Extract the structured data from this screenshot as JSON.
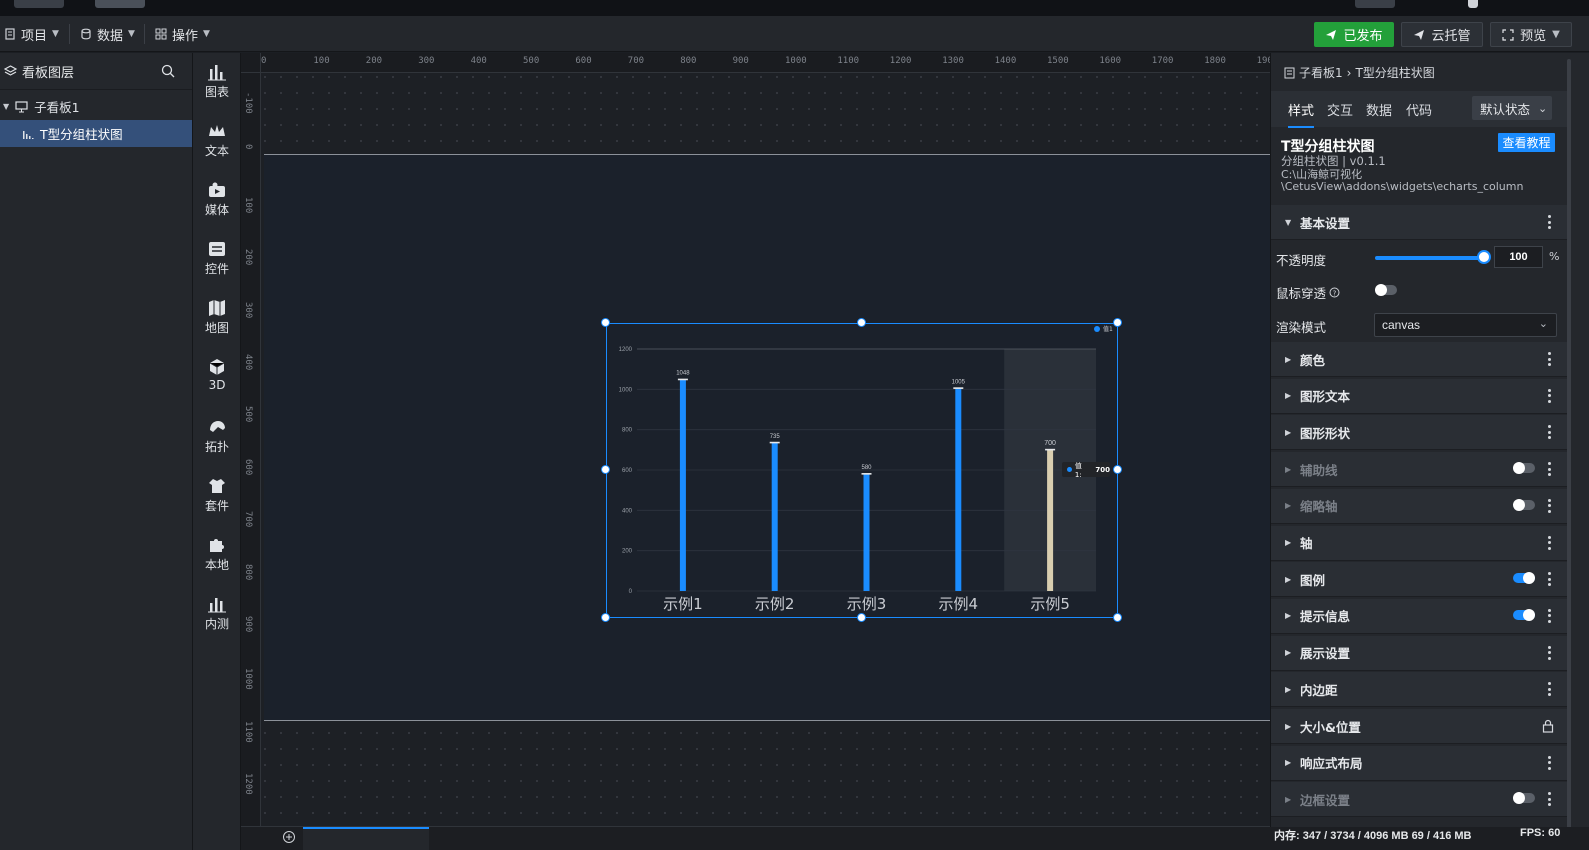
{
  "toolbar": {
    "menus": [
      {
        "label": "项目",
        "icon": "file-icon"
      },
      {
        "label": "数据",
        "icon": "database-icon"
      },
      {
        "label": "操作",
        "icon": "grid-icon"
      }
    ],
    "published_label": "已发布",
    "cloud_label": "云托管",
    "preview_label": "预览"
  },
  "layers": {
    "title": "看板图层",
    "tree": [
      {
        "label": "子看板1",
        "icon": "board-icon",
        "selected": false
      },
      {
        "label": "T型分组柱状图",
        "icon": "bar-chart-icon",
        "selected": true
      }
    ]
  },
  "rail": {
    "items": [
      {
        "label": "图表",
        "icon": "chart-icon"
      },
      {
        "label": "文本",
        "icon": "crown-icon"
      },
      {
        "label": "媒体",
        "icon": "media-icon"
      },
      {
        "label": "控件",
        "icon": "widget-icon"
      },
      {
        "label": "地图",
        "icon": "map-icon"
      },
      {
        "label": "3D",
        "icon": "cube-icon"
      },
      {
        "label": "拓扑",
        "icon": "topology-icon"
      },
      {
        "label": "套件",
        "icon": "shirt-icon"
      },
      {
        "label": "本地",
        "icon": "puzzle-icon"
      },
      {
        "label": "内测",
        "icon": "beta-chart-icon"
      }
    ]
  },
  "rulers": {
    "horizontal": [
      "0",
      "100",
      "200",
      "300",
      "400",
      "500",
      "600",
      "700",
      "800",
      "900",
      "1000",
      "1100",
      "1200",
      "1300",
      "1400",
      "1500",
      "1600",
      "1700",
      "1800",
      "1900"
    ],
    "vertical": [
      "-100",
      "0",
      "100",
      "200",
      "300",
      "400",
      "500",
      "600",
      "700",
      "800",
      "900",
      "1000",
      "1100",
      "1200"
    ]
  },
  "chart_data": {
    "type": "bar",
    "categories": [
      "示例1",
      "示例2",
      "示例3",
      "示例4",
      "示例5"
    ],
    "series": [
      {
        "name": "值1",
        "values": [
          1048,
          735,
          580,
          1005,
          700
        ]
      }
    ],
    "ylim": [
      0,
      1200
    ],
    "yticks": [
      0,
      200,
      400,
      600,
      800,
      1000,
      1200
    ],
    "grid": true,
    "legend": "top-right",
    "highlighted_category": "示例5",
    "bar_color": "#1a8cff",
    "highlight_bar_color": "#d9ceb0",
    "tooltip": {
      "series": "值1:",
      "value": "700"
    }
  },
  "props": {
    "breadcrumb": [
      "子看板1",
      "T型分组柱状图"
    ],
    "tabs": [
      "样式",
      "交互",
      "数据",
      "代码"
    ],
    "state_select": "默认状态",
    "component_title": "T型分组柱状图",
    "tutorial_label": "查看教程",
    "component_version": "分组柱状图 | v0.1.1",
    "component_path_line1": "C:\\山海鲸可视化",
    "component_path_line2": "\\CetusView\\addons\\widgets\\echarts_column",
    "basic_section": "基本设置",
    "opacity_label": "不透明度",
    "opacity_value": "100",
    "opacity_unit": "%",
    "mouse_through_label": "鼠标穿透",
    "render_mode_label": "渲染模式",
    "render_mode_value": "canvas",
    "sections": [
      {
        "label": "颜色",
        "kind": "more"
      },
      {
        "label": "图形文本",
        "kind": "more"
      },
      {
        "label": "图形形状",
        "kind": "more"
      },
      {
        "label": "辅助线",
        "kind": "toggle",
        "on": false,
        "dim": true
      },
      {
        "label": "缩略轴",
        "kind": "toggle",
        "on": false,
        "dim": true
      },
      {
        "label": "轴",
        "kind": "more"
      },
      {
        "label": "图例",
        "kind": "toggle",
        "on": true
      },
      {
        "label": "提示信息",
        "kind": "toggle",
        "on": true
      },
      {
        "label": "展示设置",
        "kind": "more"
      },
      {
        "label": "内边距",
        "kind": "more"
      },
      {
        "label": "大小&位置",
        "kind": "lock"
      },
      {
        "label": "响应式布局",
        "kind": "more"
      },
      {
        "label": "边框设置",
        "kind": "toggle",
        "on": false,
        "dim": true
      }
    ]
  },
  "status": {
    "memory": "内存:  347 / 3734 / 4096 MB  69 / 416 MB",
    "fps": "FPS:  60"
  },
  "colors": {
    "accent": "#1a8cff",
    "published": "#23a03a"
  }
}
